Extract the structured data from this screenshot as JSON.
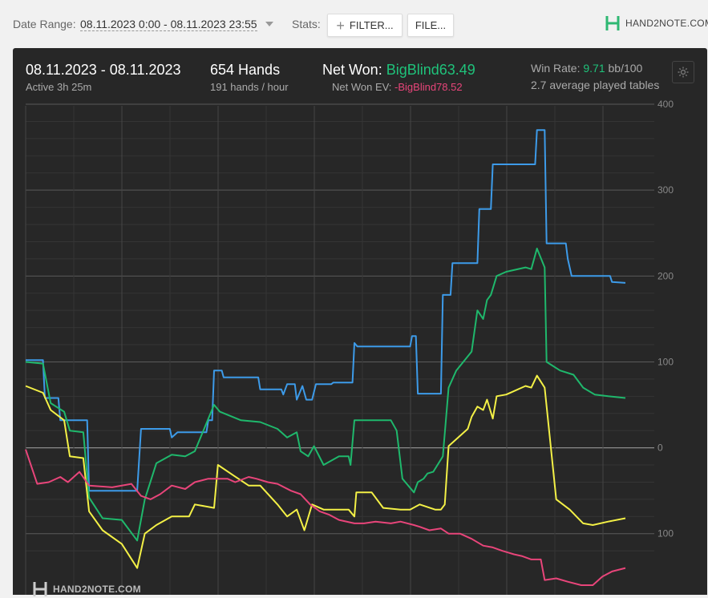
{
  "toolbar": {
    "date_range_label": "Date Range:",
    "date_range_value": "08.11.2023 0:00 - 08.11.2023 23:55",
    "stats_label": "Stats:",
    "filter_label": "FILTER...",
    "file_label": "FILE...",
    "brand": "HAND2NOTE.COM"
  },
  "summary": {
    "date": "08.11.2023 - 08.11.2023",
    "active": "Active 3h 25m",
    "hands": "654 Hands",
    "hands_per_hour": "191 hands / hour",
    "net_won_label": "Net Won: ",
    "net_won_value": "BigBlind63.49",
    "net_won_ev_label": "Net Won  EV: ",
    "net_won_ev_value": "-BigBlind78.52",
    "win_rate_label": "Win Rate: ",
    "win_rate_value": "9.71",
    "win_rate_unit": " bb/100",
    "avg_tables": "2.7 average played tables"
  },
  "watermark": "HAND2NOTE.COM",
  "colors": {
    "blue": "#3d9be9",
    "green": "#1fb86c",
    "yellow": "#f3f046",
    "pink": "#e8457a",
    "panel": "#272727"
  },
  "chart_data": {
    "type": "line",
    "ylim": [
      -110,
      400
    ],
    "xlim": [
      0,
      654
    ],
    "y_tick_labels": [
      "400",
      "300",
      "200",
      "100",
      "0",
      "100"
    ],
    "y_ticks": [
      400,
      300,
      200,
      100,
      0,
      -100
    ],
    "grid": true,
    "series": [
      {
        "key": "blue",
        "color": "#3d9be9",
        "points": [
          [
            0,
            102
          ],
          [
            18,
            102
          ],
          [
            20,
            58
          ],
          [
            34,
            58
          ],
          [
            36,
            32
          ],
          [
            64,
            32
          ],
          [
            66,
            -50
          ],
          [
            116,
            -50
          ],
          [
            120,
            22
          ],
          [
            150,
            22
          ],
          [
            152,
            12
          ],
          [
            158,
            18
          ],
          [
            188,
            18
          ],
          [
            190,
            32
          ],
          [
            194,
            32
          ],
          [
            196,
            90
          ],
          [
            204,
            90
          ],
          [
            206,
            82
          ],
          [
            242,
            82
          ],
          [
            244,
            68
          ],
          [
            266,
            68
          ],
          [
            268,
            62
          ],
          [
            272,
            74
          ],
          [
            280,
            74
          ],
          [
            282,
            56
          ],
          [
            288,
            72
          ],
          [
            292,
            56
          ],
          [
            298,
            56
          ],
          [
            302,
            74
          ],
          [
            318,
            74
          ],
          [
            320,
            76
          ],
          [
            340,
            76
          ],
          [
            342,
            122
          ],
          [
            345,
            118
          ],
          [
            400,
            118
          ],
          [
            402,
            130
          ],
          [
            406,
            130
          ],
          [
            408,
            63
          ],
          [
            432,
            63
          ],
          [
            434,
            178
          ],
          [
            442,
            178
          ],
          [
            444,
            215
          ],
          [
            470,
            215
          ],
          [
            472,
            278
          ],
          [
            484,
            278
          ],
          [
            486,
            330
          ],
          [
            530,
            330
          ],
          [
            532,
            370
          ],
          [
            540,
            370
          ],
          [
            542,
            238
          ],
          [
            562,
            238
          ],
          [
            564,
            220
          ],
          [
            568,
            200
          ],
          [
            608,
            200
          ],
          [
            610,
            193
          ],
          [
            624,
            192
          ]
        ]
      },
      {
        "key": "green",
        "color": "#1fb86c",
        "points": [
          [
            0,
            100
          ],
          [
            18,
            98
          ],
          [
            26,
            52
          ],
          [
            40,
            42
          ],
          [
            46,
            20
          ],
          [
            60,
            18
          ],
          [
            66,
            -58
          ],
          [
            80,
            -82
          ],
          [
            100,
            -84
          ],
          [
            116,
            -108
          ],
          [
            124,
            -60
          ],
          [
            136,
            -18
          ],
          [
            152,
            -8
          ],
          [
            166,
            -10
          ],
          [
            176,
            -4
          ],
          [
            196,
            50
          ],
          [
            202,
            42
          ],
          [
            224,
            32
          ],
          [
            244,
            30
          ],
          [
            262,
            22
          ],
          [
            272,
            12
          ],
          [
            282,
            18
          ],
          [
            286,
            -4
          ],
          [
            294,
            -10
          ],
          [
            300,
            2
          ],
          [
            310,
            -20
          ],
          [
            326,
            -10
          ],
          [
            336,
            -10
          ],
          [
            338,
            -20
          ],
          [
            342,
            32
          ],
          [
            370,
            32
          ],
          [
            380,
            32
          ],
          [
            386,
            20
          ],
          [
            392,
            -36
          ],
          [
            404,
            -52
          ],
          [
            408,
            -40
          ],
          [
            414,
            -36
          ],
          [
            418,
            -30
          ],
          [
            424,
            -28
          ],
          [
            434,
            -10
          ],
          [
            440,
            70
          ],
          [
            448,
            90
          ],
          [
            464,
            112
          ],
          [
            470,
            160
          ],
          [
            476,
            150
          ],
          [
            480,
            172
          ],
          [
            484,
            178
          ],
          [
            490,
            200
          ],
          [
            500,
            205
          ],
          [
            520,
            210
          ],
          [
            526,
            208
          ],
          [
            532,
            232
          ],
          [
            540,
            210
          ],
          [
            542,
            100
          ],
          [
            556,
            90
          ],
          [
            570,
            85
          ],
          [
            580,
            70
          ],
          [
            592,
            62
          ],
          [
            606,
            60
          ],
          [
            624,
            58
          ]
        ]
      },
      {
        "key": "yellow",
        "color": "#f3f046",
        "points": [
          [
            0,
            72
          ],
          [
            18,
            64
          ],
          [
            26,
            44
          ],
          [
            40,
            32
          ],
          [
            46,
            -10
          ],
          [
            60,
            -12
          ],
          [
            66,
            -74
          ],
          [
            80,
            -96
          ],
          [
            100,
            -112
          ],
          [
            116,
            -140
          ],
          [
            124,
            -100
          ],
          [
            136,
            -90
          ],
          [
            152,
            -80
          ],
          [
            170,
            -80
          ],
          [
            176,
            -66
          ],
          [
            196,
            -70
          ],
          [
            200,
            -20
          ],
          [
            216,
            -32
          ],
          [
            232,
            -44
          ],
          [
            244,
            -44
          ],
          [
            262,
            -66
          ],
          [
            272,
            -80
          ],
          [
            282,
            -72
          ],
          [
            290,
            -96
          ],
          [
            298,
            -66
          ],
          [
            310,
            -72
          ],
          [
            326,
            -72
          ],
          [
            336,
            -72
          ],
          [
            342,
            -80
          ],
          [
            344,
            -52
          ],
          [
            360,
            -52
          ],
          [
            372,
            -70
          ],
          [
            390,
            -72
          ],
          [
            400,
            -72
          ],
          [
            410,
            -66
          ],
          [
            426,
            -72
          ],
          [
            432,
            -72
          ],
          [
            436,
            -66
          ],
          [
            440,
            2
          ],
          [
            448,
            10
          ],
          [
            460,
            22
          ],
          [
            464,
            36
          ],
          [
            470,
            48
          ],
          [
            476,
            44
          ],
          [
            480,
            56
          ],
          [
            486,
            34
          ],
          [
            490,
            60
          ],
          [
            500,
            62
          ],
          [
            520,
            72
          ],
          [
            526,
            70
          ],
          [
            532,
            84
          ],
          [
            540,
            70
          ],
          [
            552,
            -60
          ],
          [
            566,
            -72
          ],
          [
            580,
            -88
          ],
          [
            590,
            -90
          ],
          [
            606,
            -86
          ],
          [
            624,
            -82
          ]
        ]
      },
      {
        "key": "pink",
        "color": "#e8457a",
        "points": [
          [
            0,
            -2
          ],
          [
            12,
            -42
          ],
          [
            24,
            -40
          ],
          [
            36,
            -34
          ],
          [
            44,
            -40
          ],
          [
            56,
            -28
          ],
          [
            66,
            -44
          ],
          [
            90,
            -46
          ],
          [
            110,
            -42
          ],
          [
            120,
            -56
          ],
          [
            130,
            -60
          ],
          [
            140,
            -54
          ],
          [
            152,
            -44
          ],
          [
            166,
            -48
          ],
          [
            176,
            -40
          ],
          [
            190,
            -36
          ],
          [
            210,
            -36
          ],
          [
            218,
            -40
          ],
          [
            232,
            -34
          ],
          [
            240,
            -36
          ],
          [
            252,
            -40
          ],
          [
            262,
            -42
          ],
          [
            276,
            -50
          ],
          [
            286,
            -54
          ],
          [
            296,
            -66
          ],
          [
            306,
            -74
          ],
          [
            316,
            -78
          ],
          [
            326,
            -84
          ],
          [
            342,
            -88
          ],
          [
            352,
            -88
          ],
          [
            364,
            -86
          ],
          [
            380,
            -88
          ],
          [
            390,
            -86
          ],
          [
            404,
            -90
          ],
          [
            410,
            -92
          ],
          [
            420,
            -96
          ],
          [
            432,
            -94
          ],
          [
            440,
            -100
          ],
          [
            452,
            -100
          ],
          [
            464,
            -106
          ],
          [
            476,
            -114
          ],
          [
            486,
            -116
          ],
          [
            496,
            -120
          ],
          [
            508,
            -124
          ],
          [
            516,
            -126
          ],
          [
            526,
            -130
          ],
          [
            536,
            -130
          ],
          [
            540,
            -154
          ],
          [
            552,
            -152
          ],
          [
            564,
            -156
          ],
          [
            578,
            -160
          ],
          [
            590,
            -160
          ],
          [
            600,
            -150
          ],
          [
            610,
            -144
          ],
          [
            624,
            -140
          ]
        ]
      }
    ]
  }
}
